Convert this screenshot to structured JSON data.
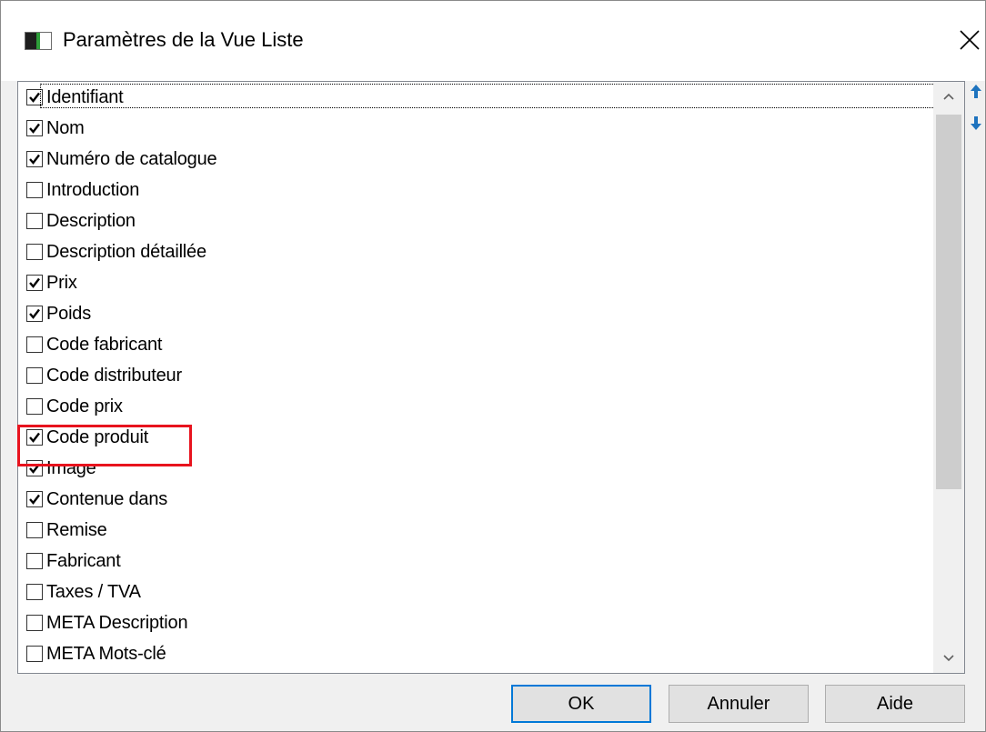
{
  "window": {
    "title": "Paramètres de la Vue Liste",
    "icon": "app-window-icon",
    "close_icon": "close-icon"
  },
  "list": {
    "items": [
      {
        "label": "Identifiant",
        "checked": true
      },
      {
        "label": "Nom",
        "checked": true
      },
      {
        "label": "Numéro de catalogue",
        "checked": true
      },
      {
        "label": "Introduction",
        "checked": false
      },
      {
        "label": "Description",
        "checked": false
      },
      {
        "label": "Description détaillée",
        "checked": false
      },
      {
        "label": "Prix",
        "checked": true
      },
      {
        "label": "Poids",
        "checked": true
      },
      {
        "label": "Code fabricant",
        "checked": false
      },
      {
        "label": "Code distributeur",
        "checked": false
      },
      {
        "label": "Code prix",
        "checked": false
      },
      {
        "label": "Code produit",
        "checked": true
      },
      {
        "label": "Image",
        "checked": true
      },
      {
        "label": "Contenue dans",
        "checked": true
      },
      {
        "label": "Remise",
        "checked": false
      },
      {
        "label": "Fabricant",
        "checked": false
      },
      {
        "label": "Taxes / TVA",
        "checked": false
      },
      {
        "label": "META Description",
        "checked": false
      },
      {
        "label": "META Mots-clé",
        "checked": false
      }
    ],
    "focused_index": 0,
    "highlighted_index": 11,
    "highlight_color": "#e8131e"
  },
  "scrollbar": {
    "up_icon": "chevron-up-icon",
    "down_icon": "chevron-down-icon"
  },
  "reorder": {
    "up_icon": "arrow-up-icon",
    "down_icon": "arrow-down-icon",
    "color": "#1e73be"
  },
  "buttons": {
    "ok": "OK",
    "cancel": "Annuler",
    "help": "Aide"
  }
}
